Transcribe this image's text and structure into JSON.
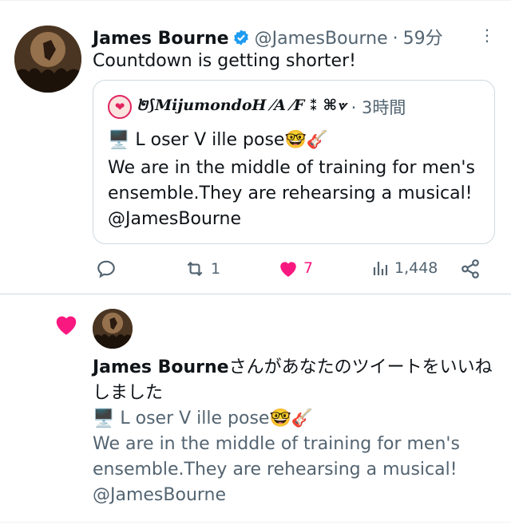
{
  "tweet": {
    "author_name": "James Bourne",
    "handle": "@JamesBourne",
    "separator": "·",
    "time": "59分",
    "text": "Countdown is getting shorter!",
    "quote": {
      "author_name": "២⟆MijumondoH ⁄A ⁄F ⁑ ⌘⟇",
      "time": "3時間",
      "line1": "🖥️ L oser V ille pose🤓🎸",
      "body": "We are in the middle of training for men's ensemble.They are rehearsing a musical! @JamesBourne"
    },
    "actions": {
      "reply_count": "",
      "retweet_count": "1",
      "like_count": "7",
      "views_count": "1,448"
    }
  },
  "notification": {
    "actor_name": "James Bourne",
    "action_text": "さんがあなたのツイートをいいねしました",
    "quoted_line1": "🖥️ L oser V ille pose🤓🎸",
    "quoted_body": "We are in the middle of training for men's ensemble.They are rehearsing a musical! @JamesBourne"
  },
  "colors": {
    "accent_like": "#f91880",
    "verified": "#1d9bf0",
    "secondary_text": "#536471"
  }
}
